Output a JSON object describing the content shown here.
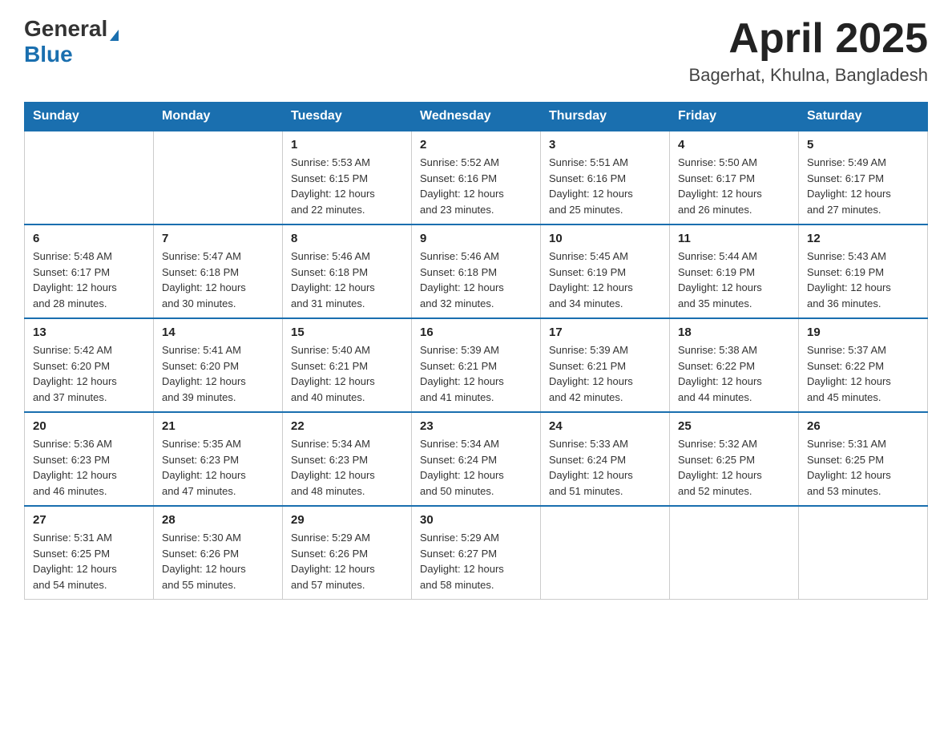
{
  "logo": {
    "general": "General",
    "blue": "Blue",
    "triangle": "▶"
  },
  "title": {
    "month_year": "April 2025",
    "location": "Bagerhat, Khulna, Bangladesh"
  },
  "weekdays": [
    "Sunday",
    "Monday",
    "Tuesday",
    "Wednesday",
    "Thursday",
    "Friday",
    "Saturday"
  ],
  "weeks": [
    [
      {
        "day": "",
        "info": ""
      },
      {
        "day": "",
        "info": ""
      },
      {
        "day": "1",
        "info": "Sunrise: 5:53 AM\nSunset: 6:15 PM\nDaylight: 12 hours\nand 22 minutes."
      },
      {
        "day": "2",
        "info": "Sunrise: 5:52 AM\nSunset: 6:16 PM\nDaylight: 12 hours\nand 23 minutes."
      },
      {
        "day": "3",
        "info": "Sunrise: 5:51 AM\nSunset: 6:16 PM\nDaylight: 12 hours\nand 25 minutes."
      },
      {
        "day": "4",
        "info": "Sunrise: 5:50 AM\nSunset: 6:17 PM\nDaylight: 12 hours\nand 26 minutes."
      },
      {
        "day": "5",
        "info": "Sunrise: 5:49 AM\nSunset: 6:17 PM\nDaylight: 12 hours\nand 27 minutes."
      }
    ],
    [
      {
        "day": "6",
        "info": "Sunrise: 5:48 AM\nSunset: 6:17 PM\nDaylight: 12 hours\nand 28 minutes."
      },
      {
        "day": "7",
        "info": "Sunrise: 5:47 AM\nSunset: 6:18 PM\nDaylight: 12 hours\nand 30 minutes."
      },
      {
        "day": "8",
        "info": "Sunrise: 5:46 AM\nSunset: 6:18 PM\nDaylight: 12 hours\nand 31 minutes."
      },
      {
        "day": "9",
        "info": "Sunrise: 5:46 AM\nSunset: 6:18 PM\nDaylight: 12 hours\nand 32 minutes."
      },
      {
        "day": "10",
        "info": "Sunrise: 5:45 AM\nSunset: 6:19 PM\nDaylight: 12 hours\nand 34 minutes."
      },
      {
        "day": "11",
        "info": "Sunrise: 5:44 AM\nSunset: 6:19 PM\nDaylight: 12 hours\nand 35 minutes."
      },
      {
        "day": "12",
        "info": "Sunrise: 5:43 AM\nSunset: 6:19 PM\nDaylight: 12 hours\nand 36 minutes."
      }
    ],
    [
      {
        "day": "13",
        "info": "Sunrise: 5:42 AM\nSunset: 6:20 PM\nDaylight: 12 hours\nand 37 minutes."
      },
      {
        "day": "14",
        "info": "Sunrise: 5:41 AM\nSunset: 6:20 PM\nDaylight: 12 hours\nand 39 minutes."
      },
      {
        "day": "15",
        "info": "Sunrise: 5:40 AM\nSunset: 6:21 PM\nDaylight: 12 hours\nand 40 minutes."
      },
      {
        "day": "16",
        "info": "Sunrise: 5:39 AM\nSunset: 6:21 PM\nDaylight: 12 hours\nand 41 minutes."
      },
      {
        "day": "17",
        "info": "Sunrise: 5:39 AM\nSunset: 6:21 PM\nDaylight: 12 hours\nand 42 minutes."
      },
      {
        "day": "18",
        "info": "Sunrise: 5:38 AM\nSunset: 6:22 PM\nDaylight: 12 hours\nand 44 minutes."
      },
      {
        "day": "19",
        "info": "Sunrise: 5:37 AM\nSunset: 6:22 PM\nDaylight: 12 hours\nand 45 minutes."
      }
    ],
    [
      {
        "day": "20",
        "info": "Sunrise: 5:36 AM\nSunset: 6:23 PM\nDaylight: 12 hours\nand 46 minutes."
      },
      {
        "day": "21",
        "info": "Sunrise: 5:35 AM\nSunset: 6:23 PM\nDaylight: 12 hours\nand 47 minutes."
      },
      {
        "day": "22",
        "info": "Sunrise: 5:34 AM\nSunset: 6:23 PM\nDaylight: 12 hours\nand 48 minutes."
      },
      {
        "day": "23",
        "info": "Sunrise: 5:34 AM\nSunset: 6:24 PM\nDaylight: 12 hours\nand 50 minutes."
      },
      {
        "day": "24",
        "info": "Sunrise: 5:33 AM\nSunset: 6:24 PM\nDaylight: 12 hours\nand 51 minutes."
      },
      {
        "day": "25",
        "info": "Sunrise: 5:32 AM\nSunset: 6:25 PM\nDaylight: 12 hours\nand 52 minutes."
      },
      {
        "day": "26",
        "info": "Sunrise: 5:31 AM\nSunset: 6:25 PM\nDaylight: 12 hours\nand 53 minutes."
      }
    ],
    [
      {
        "day": "27",
        "info": "Sunrise: 5:31 AM\nSunset: 6:25 PM\nDaylight: 12 hours\nand 54 minutes."
      },
      {
        "day": "28",
        "info": "Sunrise: 5:30 AM\nSunset: 6:26 PM\nDaylight: 12 hours\nand 55 minutes."
      },
      {
        "day": "29",
        "info": "Sunrise: 5:29 AM\nSunset: 6:26 PM\nDaylight: 12 hours\nand 57 minutes."
      },
      {
        "day": "30",
        "info": "Sunrise: 5:29 AM\nSunset: 6:27 PM\nDaylight: 12 hours\nand 58 minutes."
      },
      {
        "day": "",
        "info": ""
      },
      {
        "day": "",
        "info": ""
      },
      {
        "day": "",
        "info": ""
      }
    ]
  ]
}
